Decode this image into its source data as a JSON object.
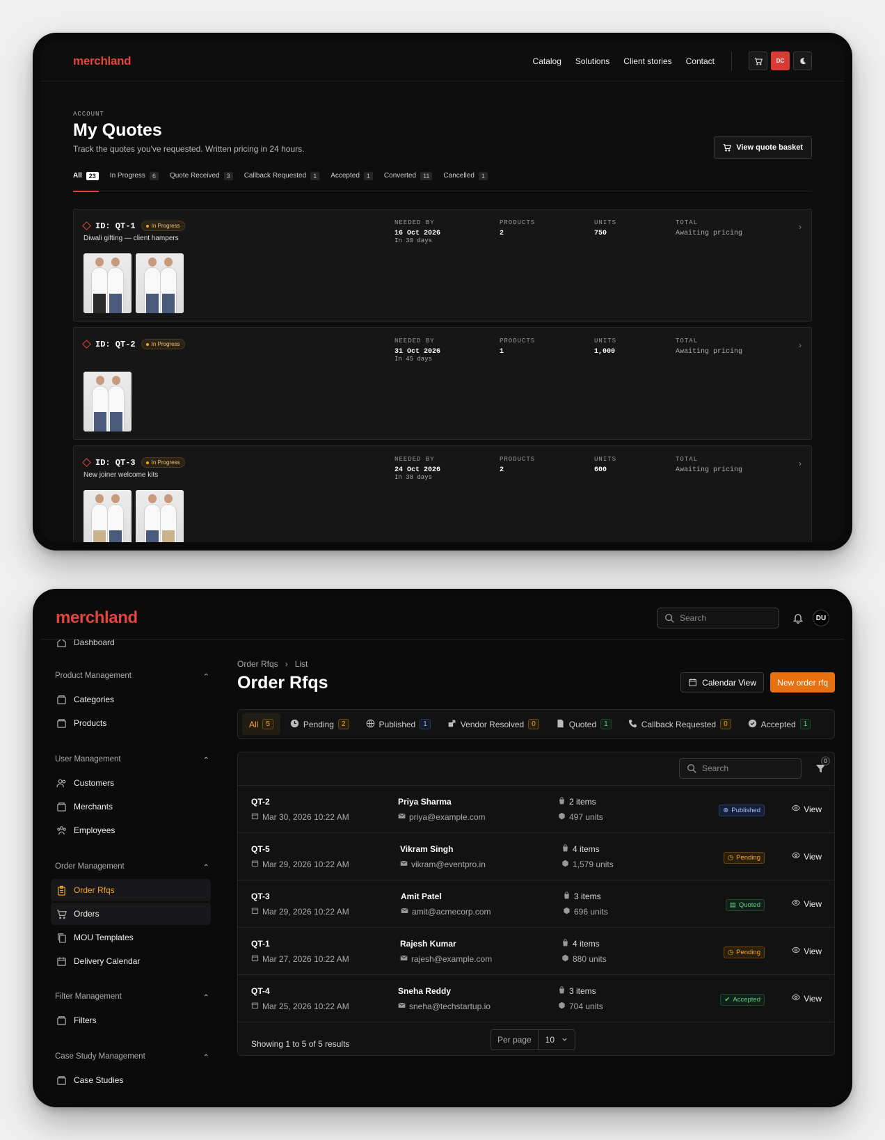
{
  "frame1": {
    "logo": "merchland",
    "nav": [
      "Catalog",
      "Solutions",
      "Client stories",
      "Contact"
    ],
    "avatar_initials": "DC",
    "eyebrow": "ACCOUNT",
    "title": "My Quotes",
    "subtitle": "Track the quotes you've requested. Written pricing in 24 hours.",
    "basket_label": "View quote basket",
    "tabs": [
      {
        "label": "All",
        "count": "23"
      },
      {
        "label": "In Progress",
        "count": "6"
      },
      {
        "label": "Quote Received",
        "count": "3"
      },
      {
        "label": "Callback Requested",
        "count": "1"
      },
      {
        "label": "Accepted",
        "count": "1"
      },
      {
        "label": "Converted",
        "count": "11"
      },
      {
        "label": "Cancelled",
        "count": "1"
      }
    ],
    "col_labels": {
      "needed": "NEEDED BY",
      "products": "PRODUCTS",
      "units": "UNITS",
      "total": "TOTAL"
    },
    "quotes": [
      {
        "id": "ID: QT-1",
        "status": "In Progress",
        "desc": "Diwali gifting — client hampers",
        "needed": "16 Oct 2026",
        "relative": "In 30 days",
        "products": "2",
        "units": "750",
        "total": "Awaiting pricing"
      },
      {
        "id": "ID: QT-2",
        "status": "In Progress",
        "desc": "",
        "needed": "31 Oct 2026",
        "relative": "In 45 days",
        "products": "1",
        "units": "1,000",
        "total": "Awaiting pricing"
      },
      {
        "id": "ID: QT-3",
        "status": "In Progress",
        "desc": "New joiner welcome kits",
        "needed": "24 Oct 2026",
        "relative": "In 38 days",
        "products": "2",
        "units": "600",
        "total": "Awaiting pricing"
      }
    ]
  },
  "frame2": {
    "logo": "merchland",
    "search_placeholder": "Search",
    "avatar_initials": "DU",
    "sidebar": {
      "dashboard": "Dashboard",
      "product_mgmt": "Product Management",
      "categories": "Categories",
      "products": "Products",
      "user_mgmt": "User Management",
      "customers": "Customers",
      "merchants": "Merchants",
      "employees": "Employees",
      "order_mgmt": "Order Management",
      "order_rfqs": "Order Rfqs",
      "orders": "Orders",
      "mou": "MOU Templates",
      "delivery": "Delivery Calendar",
      "filter_mgmt": "Filter Management",
      "filters": "Filters",
      "case_mgmt": "Case Study Management",
      "case_studies": "Case Studies"
    },
    "breadcrumb": [
      "Order Rfqs",
      "List"
    ],
    "title": "Order Rfqs",
    "calendar_btn": "Calendar View",
    "new_btn": "New order rfq",
    "tabs": [
      {
        "label": "All",
        "count": "5"
      },
      {
        "label": "Pending",
        "count": "2"
      },
      {
        "label": "Published",
        "count": "1"
      },
      {
        "label": "Vendor Resolved",
        "count": "0"
      },
      {
        "label": "Quoted",
        "count": "1"
      },
      {
        "label": "Callback Requested",
        "count": "0"
      },
      {
        "label": "Accepted",
        "count": "1"
      }
    ],
    "table_search": "Search",
    "filter_count": "0",
    "rows": [
      {
        "id": "QT-2",
        "date": "Mar 30, 2026 10:22 AM",
        "name": "Priya Sharma",
        "email": "priya@example.com",
        "items": "2 items",
        "units": "497 units",
        "status": "Published",
        "view": "View"
      },
      {
        "id": "QT-5",
        "date": "Mar 29, 2026 10:22 AM",
        "name": "Vikram Singh",
        "email": "vikram@eventpro.in",
        "items": "4 items",
        "units": "1,579 units",
        "status": "Pending",
        "view": "View"
      },
      {
        "id": "QT-3",
        "date": "Mar 29, 2026 10:22 AM",
        "name": "Amit Patel",
        "email": "amit@acmecorp.com",
        "items": "3 items",
        "units": "696 units",
        "status": "Quoted",
        "view": "View"
      },
      {
        "id": "QT-1",
        "date": "Mar 27, 2026 10:22 AM",
        "name": "Rajesh Kumar",
        "email": "rajesh@example.com",
        "items": "4 items",
        "units": "880 units",
        "status": "Pending",
        "view": "View"
      },
      {
        "id": "QT-4",
        "date": "Mar 25, 2026 10:22 AM",
        "name": "Sneha Reddy",
        "email": "sneha@techstartup.io",
        "items": "3 items",
        "units": "704 units",
        "status": "Accepted",
        "view": "View"
      }
    ],
    "footer": "Showing 1 to 5 of 5 results",
    "per_page_label": "Per page",
    "per_page_value": "10"
  }
}
